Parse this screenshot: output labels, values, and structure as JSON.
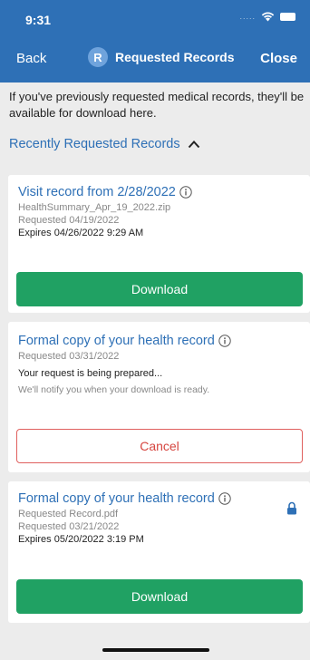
{
  "status_bar": {
    "time": "9:31",
    "signal": "....."
  },
  "nav": {
    "back_label": "Back",
    "avatar_initial": "R",
    "title": "Requested Records",
    "close_label": "Close"
  },
  "intro_text": "If you've previously requested medical records, they'll be available for download here.",
  "section": {
    "title": "Recently Requested Records",
    "icon": "chevron-up-icon"
  },
  "cards": [
    {
      "title": "Visit record from 2/28/2022",
      "filename": "HealthSummary_Apr_19_2022.zip",
      "requested": "Requested 04/19/2022",
      "expires": "Expires 04/26/2022 9:29 AM",
      "button_label": "Download"
    },
    {
      "title": "Formal copy of your health record",
      "requested": "Requested 03/31/2022",
      "status": "Your request is being prepared...",
      "note": "We'll notify you when your download is ready.",
      "button_label": "Cancel"
    },
    {
      "title": "Formal copy of your health record",
      "filename": "Requested Record.pdf",
      "requested": "Requested 03/21/2022",
      "expires": "Expires 05/20/2022 3:19 PM",
      "button_label": "Download",
      "icon": "lock-icon"
    }
  ],
  "colors": {
    "header": "#2e70b6",
    "primary_button": "#20a163",
    "cancel_border": "#e0605e",
    "link": "#2e70b6"
  }
}
